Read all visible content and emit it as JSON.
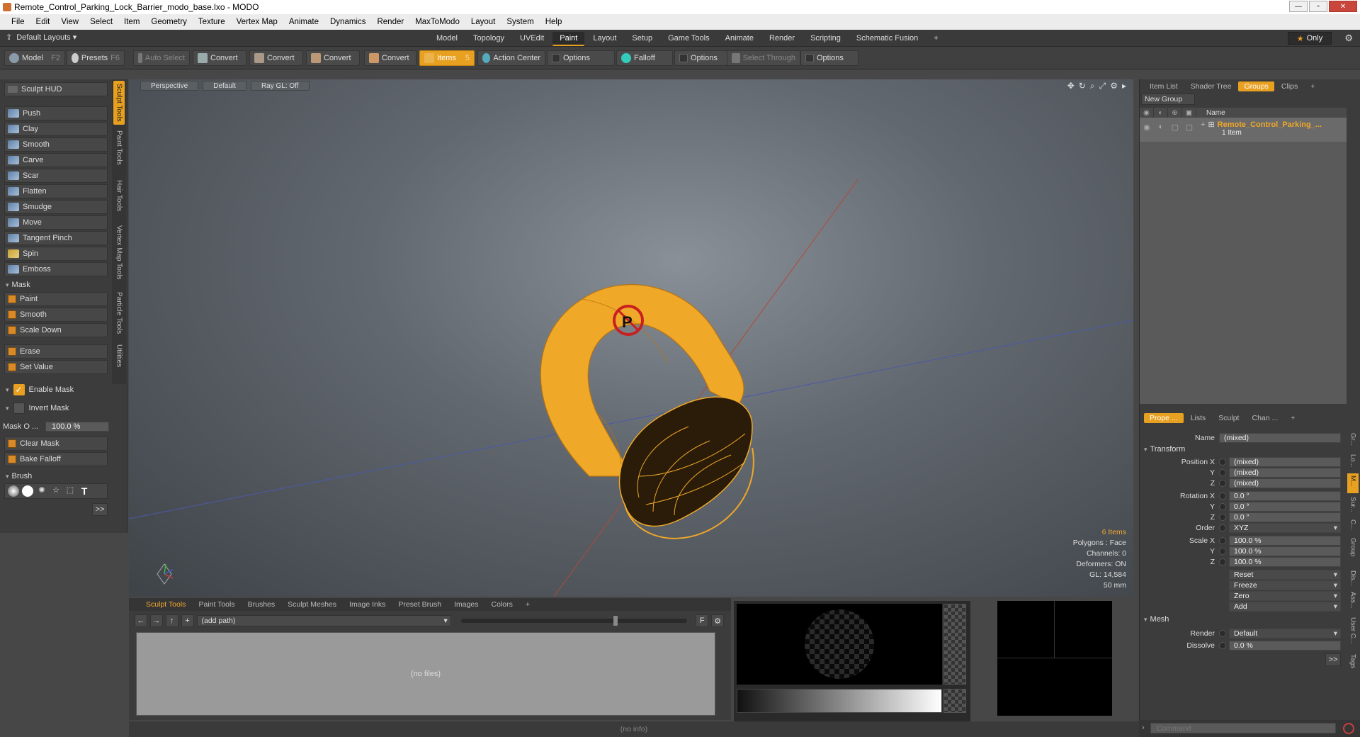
{
  "window": {
    "title": "Remote_Control_Parking_Lock_Barrier_modo_base.lxo - MODO"
  },
  "menu": [
    "File",
    "Edit",
    "View",
    "Select",
    "Item",
    "Geometry",
    "Texture",
    "Vertex Map",
    "Animate",
    "Dynamics",
    "Render",
    "MaxToModo",
    "Layout",
    "System",
    "Help"
  ],
  "layouts": {
    "label": "Default Layouts ▾"
  },
  "tabs": [
    "Model",
    "Topology",
    "UVEdit",
    "Paint",
    "Layout",
    "Setup",
    "Game Tools",
    "Animate",
    "Render",
    "Scripting",
    "Schematic Fusion"
  ],
  "active_tab": "Paint",
  "only_label": "Only",
  "toolbar": {
    "model": "Model",
    "model_key": "F2",
    "presets": "Presets",
    "presets_key": "F6",
    "auto_select": "Auto Select",
    "convert": "Convert",
    "items": "Items",
    "items_key": "5",
    "action_center": "Action Center",
    "options": "Options",
    "falloff": "Falloff",
    "select_through": "Select Through"
  },
  "left": {
    "hud": "Sculpt HUD",
    "sculpt": [
      "Push",
      "Clay",
      "Smooth",
      "Carve",
      "Scar",
      "Flatten",
      "Smudge",
      "Move",
      "Tangent Pinch",
      "Spin",
      "Emboss"
    ],
    "mask_header": "Mask",
    "mask": [
      "Paint",
      "Smooth",
      "Scale Down"
    ],
    "mask2": [
      "Erase",
      "Set Value"
    ],
    "enable_mask": "Enable Mask",
    "invert_mask": "Invert Mask",
    "mask_opacity_label": "Mask O ...",
    "mask_opacity": "100.0 %",
    "clear_mask": "Clear Mask",
    "bake_falloff": "Bake Falloff",
    "brush_header": "Brush",
    "more": ">>"
  },
  "vtabs": [
    "Sculpt Tools",
    "Paint Tools",
    "Hair Tools",
    "Vertex Map Tools",
    "Particle Tools",
    "Utilities"
  ],
  "viewport": {
    "view": "Perspective",
    "shading": "Default",
    "raygl": "Ray GL: Off",
    "info": {
      "items": "6 Items",
      "polygons": "Polygons : Face",
      "channels": "Channels: 0",
      "deformers": "Deformers: ON",
      "gl": "GL: 14,584",
      "size": "50 mm"
    }
  },
  "right": {
    "tabs": [
      "Item List",
      "Shader Tree",
      "Groups",
      "Clips"
    ],
    "active_tab": "Groups",
    "new_group": "New Group",
    "col_name": "Name",
    "group_name": "Remote_Control_Parking_...",
    "group_count": "1 Item",
    "prop_tabs": [
      "Prope ...",
      "Lists",
      "Sculpt",
      "Chan ..."
    ],
    "props": {
      "name_label": "Name",
      "name_value": "(mixed)",
      "transform": "Transform",
      "position_x": "Position X",
      "pos_x": "(mixed)",
      "y": "Y",
      "pos_y": "(mixed)",
      "z": "Z",
      "pos_z": "(mixed)",
      "rotation_x": "Rotation X",
      "rot_x": "0.0 °",
      "rot_y": "0.0 °",
      "rot_z": "0.0 °",
      "order_label": "Order",
      "order": "XYZ",
      "scale_x": "Scale X",
      "sc_x": "100.0 %",
      "sc_y": "100.0 %",
      "sc_z": "100.0 %",
      "reset": "Reset",
      "freeze": "Freeze",
      "zero": "Zero",
      "add": "Add",
      "mesh": "Mesh",
      "render_label": "Render",
      "render": "Default",
      "dissolve_label": "Dissolve",
      "dissolve": "0.0 %",
      "more": ">>"
    },
    "rvtabs": [
      "Gr...",
      "Lo...",
      "M...",
      "Sur...",
      "C...",
      "Group",
      "Dis...",
      "Ass...",
      "User C...",
      "Tags"
    ],
    "command_placeholder": "Command"
  },
  "bottom": {
    "tabs": [
      "Sculpt Tools",
      "Paint Tools",
      "Brushes",
      "Sculpt Meshes",
      "Image Inks",
      "Preset Brush",
      "Images",
      "Colors"
    ],
    "path": "(add path)",
    "no_files": "(no files)",
    "f": "F"
  },
  "status": "(no info)",
  "colors": {
    "accent": "#e8a020",
    "model": "#f0a828"
  }
}
